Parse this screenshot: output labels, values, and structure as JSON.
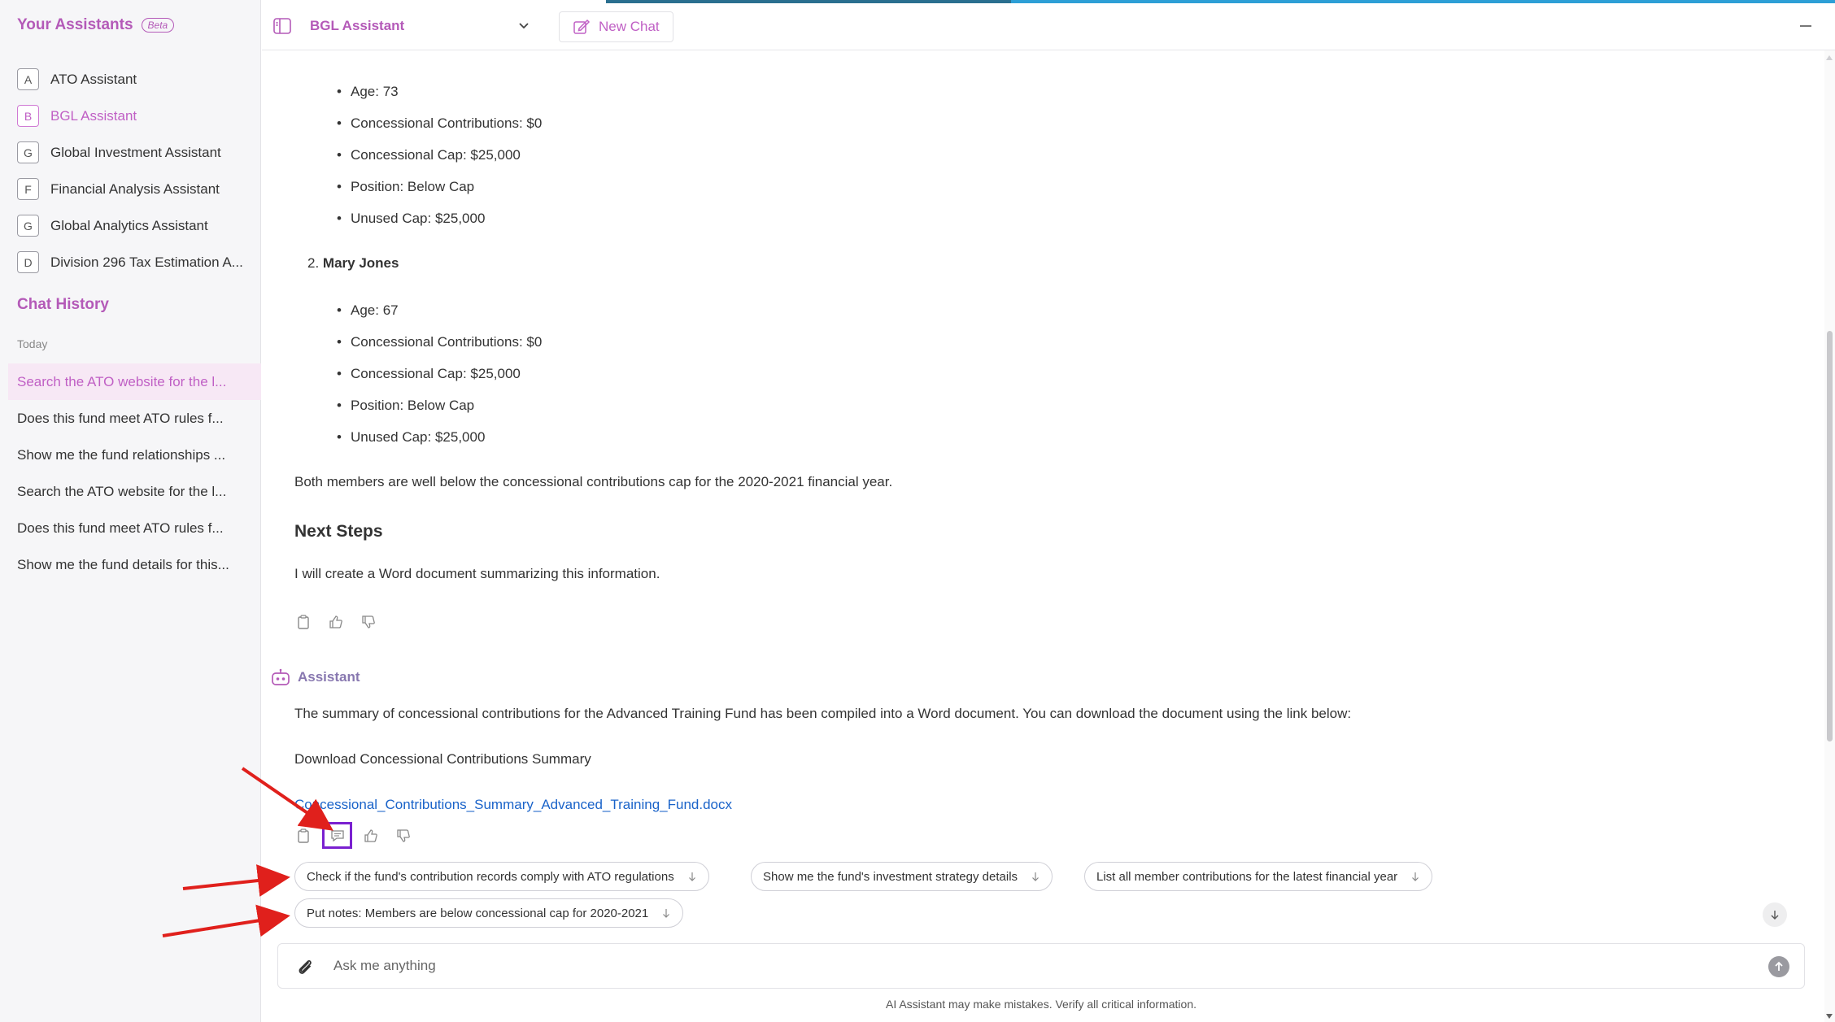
{
  "sidebar": {
    "title": "Your Assistants",
    "beta": "Beta",
    "assistants": [
      {
        "letter": "A",
        "name": "ATO Assistant"
      },
      {
        "letter": "B",
        "name": "BGL Assistant"
      },
      {
        "letter": "G",
        "name": "Global Investment Assistant"
      },
      {
        "letter": "F",
        "name": "Financial Analysis Assistant"
      },
      {
        "letter": "G",
        "name": "Global Analytics Assistant"
      },
      {
        "letter": "D",
        "name": "Division 296 Tax Estimation A..."
      }
    ],
    "history_title": "Chat History",
    "today": "Today",
    "history": [
      "Search the ATO website for the l...",
      "Does this fund meet ATO rules f...",
      "Show me the fund relationships ...",
      "Search the ATO website for the l...",
      "Does this fund meet ATO rules f...",
      "Show me the fund details for this..."
    ]
  },
  "topbar": {
    "title": "BGL Assistant",
    "new_chat": "New Chat"
  },
  "chat": {
    "member1": [
      "Age: 73",
      "Concessional Contributions: $0",
      "Concessional Cap: $25,000",
      "Position: Below Cap",
      "Unused Cap: $25,000"
    ],
    "member2_number": "2.",
    "member2_name": "Mary Jones",
    "member2": [
      "Age: 67",
      "Concessional Contributions: $0",
      "Concessional Cap: $25,000",
      "Position: Below Cap",
      "Unused Cap: $25,000"
    ],
    "summary": "Both members are well below the concessional contributions cap for the 2020-2021 financial year.",
    "next_steps_heading": "Next Steps",
    "next_steps_text": "I will create a Word document summarizing this information.",
    "assistant_label": "Assistant",
    "reply_text": "The summary of concessional contributions for the Advanced Training Fund has been compiled into a Word document. You can download the document using the link below:",
    "download_label": "Download Concessional Contributions Summary",
    "doc_link": "Concessional_Contributions_Summary_Advanced_Training_Fund.docx",
    "suggestions": [
      "Check if the fund's contribution records comply with ATO regulations",
      "Show me the fund's investment strategy details",
      "List all member contributions for the latest financial year",
      "Put notes: Members are below concessional cap for 2020-2021"
    ]
  },
  "composer": {
    "placeholder": "Ask me anything"
  },
  "disclaimer": "AI Assistant may make mistakes. Verify all critical information.",
  "colors": {
    "accent": "#b45ab8",
    "link": "#1a63c9",
    "highlight_box": "#7a20d0",
    "annotation_arrow": "#e0201c"
  }
}
